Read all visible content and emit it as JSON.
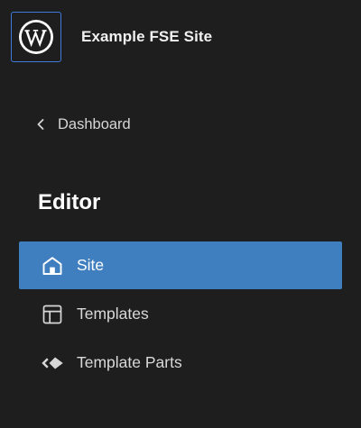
{
  "header": {
    "site_title": "Example FSE Site",
    "site_icon": "wordpress-logo-icon"
  },
  "back": {
    "label": "Dashboard",
    "icon": "chevron-left-icon"
  },
  "section": {
    "title": "Editor"
  },
  "nav": {
    "items": [
      {
        "label": "Site",
        "icon": "home-icon",
        "active": true
      },
      {
        "label": "Templates",
        "icon": "layout-icon",
        "active": false
      },
      {
        "label": "Template Parts",
        "icon": "symbol-filled-icon",
        "active": false
      }
    ]
  },
  "colors": {
    "background": "#1e1e1e",
    "accent": "#3f7fbf",
    "focus_ring": "#3f7bd8",
    "text": "#d8d8d8"
  }
}
